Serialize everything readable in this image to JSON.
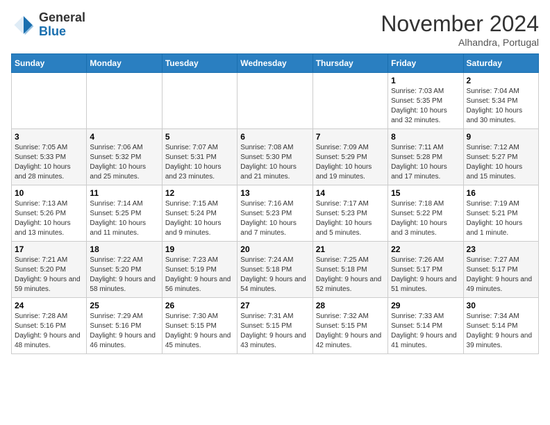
{
  "logo": {
    "general": "General",
    "blue": "Blue"
  },
  "title": "November 2024",
  "location": "Alhandra, Portugal",
  "days_header": [
    "Sunday",
    "Monday",
    "Tuesday",
    "Wednesday",
    "Thursday",
    "Friday",
    "Saturday"
  ],
  "weeks": [
    [
      {
        "day": "",
        "info": ""
      },
      {
        "day": "",
        "info": ""
      },
      {
        "day": "",
        "info": ""
      },
      {
        "day": "",
        "info": ""
      },
      {
        "day": "",
        "info": ""
      },
      {
        "day": "1",
        "info": "Sunrise: 7:03 AM\nSunset: 5:35 PM\nDaylight: 10 hours and 32 minutes."
      },
      {
        "day": "2",
        "info": "Sunrise: 7:04 AM\nSunset: 5:34 PM\nDaylight: 10 hours and 30 minutes."
      }
    ],
    [
      {
        "day": "3",
        "info": "Sunrise: 7:05 AM\nSunset: 5:33 PM\nDaylight: 10 hours and 28 minutes."
      },
      {
        "day": "4",
        "info": "Sunrise: 7:06 AM\nSunset: 5:32 PM\nDaylight: 10 hours and 25 minutes."
      },
      {
        "day": "5",
        "info": "Sunrise: 7:07 AM\nSunset: 5:31 PM\nDaylight: 10 hours and 23 minutes."
      },
      {
        "day": "6",
        "info": "Sunrise: 7:08 AM\nSunset: 5:30 PM\nDaylight: 10 hours and 21 minutes."
      },
      {
        "day": "7",
        "info": "Sunrise: 7:09 AM\nSunset: 5:29 PM\nDaylight: 10 hours and 19 minutes."
      },
      {
        "day": "8",
        "info": "Sunrise: 7:11 AM\nSunset: 5:28 PM\nDaylight: 10 hours and 17 minutes."
      },
      {
        "day": "9",
        "info": "Sunrise: 7:12 AM\nSunset: 5:27 PM\nDaylight: 10 hours and 15 minutes."
      }
    ],
    [
      {
        "day": "10",
        "info": "Sunrise: 7:13 AM\nSunset: 5:26 PM\nDaylight: 10 hours and 13 minutes."
      },
      {
        "day": "11",
        "info": "Sunrise: 7:14 AM\nSunset: 5:25 PM\nDaylight: 10 hours and 11 minutes."
      },
      {
        "day": "12",
        "info": "Sunrise: 7:15 AM\nSunset: 5:24 PM\nDaylight: 10 hours and 9 minutes."
      },
      {
        "day": "13",
        "info": "Sunrise: 7:16 AM\nSunset: 5:23 PM\nDaylight: 10 hours and 7 minutes."
      },
      {
        "day": "14",
        "info": "Sunrise: 7:17 AM\nSunset: 5:23 PM\nDaylight: 10 hours and 5 minutes."
      },
      {
        "day": "15",
        "info": "Sunrise: 7:18 AM\nSunset: 5:22 PM\nDaylight: 10 hours and 3 minutes."
      },
      {
        "day": "16",
        "info": "Sunrise: 7:19 AM\nSunset: 5:21 PM\nDaylight: 10 hours and 1 minute."
      }
    ],
    [
      {
        "day": "17",
        "info": "Sunrise: 7:21 AM\nSunset: 5:20 PM\nDaylight: 9 hours and 59 minutes."
      },
      {
        "day": "18",
        "info": "Sunrise: 7:22 AM\nSunset: 5:20 PM\nDaylight: 9 hours and 58 minutes."
      },
      {
        "day": "19",
        "info": "Sunrise: 7:23 AM\nSunset: 5:19 PM\nDaylight: 9 hours and 56 minutes."
      },
      {
        "day": "20",
        "info": "Sunrise: 7:24 AM\nSunset: 5:18 PM\nDaylight: 9 hours and 54 minutes."
      },
      {
        "day": "21",
        "info": "Sunrise: 7:25 AM\nSunset: 5:18 PM\nDaylight: 9 hours and 52 minutes."
      },
      {
        "day": "22",
        "info": "Sunrise: 7:26 AM\nSunset: 5:17 PM\nDaylight: 9 hours and 51 minutes."
      },
      {
        "day": "23",
        "info": "Sunrise: 7:27 AM\nSunset: 5:17 PM\nDaylight: 9 hours and 49 minutes."
      }
    ],
    [
      {
        "day": "24",
        "info": "Sunrise: 7:28 AM\nSunset: 5:16 PM\nDaylight: 9 hours and 48 minutes."
      },
      {
        "day": "25",
        "info": "Sunrise: 7:29 AM\nSunset: 5:16 PM\nDaylight: 9 hours and 46 minutes."
      },
      {
        "day": "26",
        "info": "Sunrise: 7:30 AM\nSunset: 5:15 PM\nDaylight: 9 hours and 45 minutes."
      },
      {
        "day": "27",
        "info": "Sunrise: 7:31 AM\nSunset: 5:15 PM\nDaylight: 9 hours and 43 minutes."
      },
      {
        "day": "28",
        "info": "Sunrise: 7:32 AM\nSunset: 5:15 PM\nDaylight: 9 hours and 42 minutes."
      },
      {
        "day": "29",
        "info": "Sunrise: 7:33 AM\nSunset: 5:14 PM\nDaylight: 9 hours and 41 minutes."
      },
      {
        "day": "30",
        "info": "Sunrise: 7:34 AM\nSunset: 5:14 PM\nDaylight: 9 hours and 39 minutes."
      }
    ]
  ]
}
